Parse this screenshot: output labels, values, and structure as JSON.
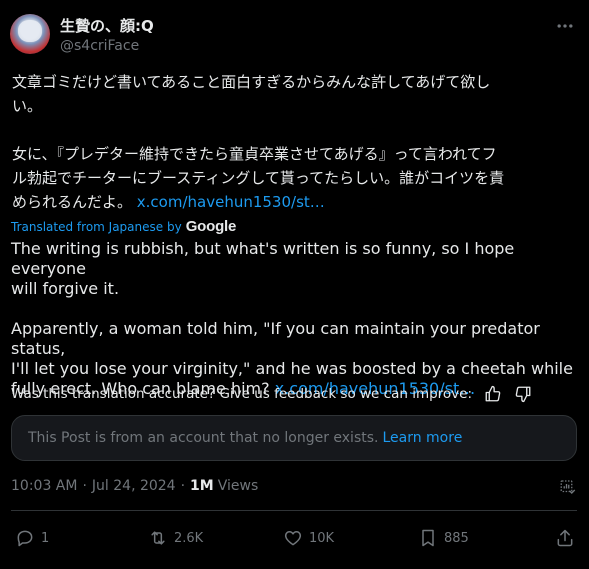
{
  "author": {
    "display_name": "生贄の、顔:Q",
    "handle": "@s4criFace"
  },
  "tweet": {
    "line1": "文章ゴミだけど書いてあること面白すぎるからみんな許してあげて欲し",
    "line2": "い。",
    "line3": "女に、『プレデター維持できたら童貞卒業させてあげる』って言われてフ",
    "line4": "ル勃起でチーターにブースティングして貰ってたらしい。誰がコイツを責",
    "line5_text": "められるんだよ。 ",
    "line5_link": "x.com/havehun1530/st…"
  },
  "translation": {
    "label": "Translated from Japanese by",
    "provider": "Google",
    "line1": "The writing is rubbish, but what's written is so funny, so I hope everyone",
    "line2": "will forgive it.",
    "line3": "Apparently, a woman told him, \"If you can maintain your predator status,",
    "line4": "I'll let you lose your virginity,\" and he was boosted by a cheetah while",
    "line5_text": "fully erect. Who can blame him? ",
    "line5_link": "x.com/havehun1530/st…"
  },
  "feedback": {
    "text": "Was this translation accurate? Give us feedback so we can improve:"
  },
  "notice": {
    "text": "This Post is from an account that no longer exists.",
    "link": "Learn more"
  },
  "meta": {
    "time": "10:03 AM",
    "date": "Jul 24, 2024",
    "views_count": "1M",
    "views_label": "Views",
    "separator": "·"
  },
  "actions": {
    "replies": "1",
    "reposts": "2.6K",
    "likes": "10K",
    "bookmarks": "885"
  },
  "colors": {
    "background": "#000000",
    "text": "#e7e9ea",
    "muted": "#71767b",
    "accent": "#1d9bf0",
    "border": "#2f3336"
  }
}
